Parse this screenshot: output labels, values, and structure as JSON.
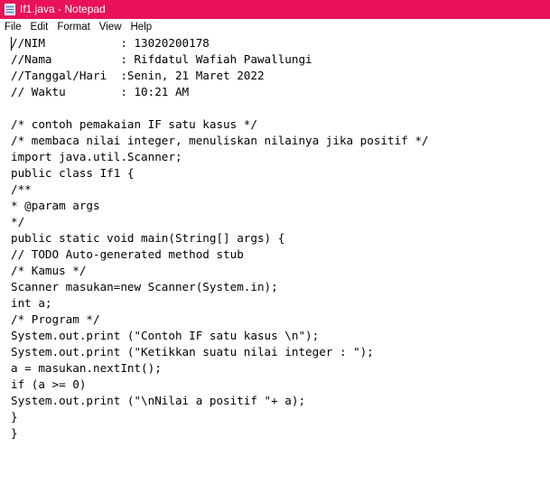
{
  "window": {
    "title": "If1.java - Notepad"
  },
  "menu": {
    "items": [
      "File",
      "Edit",
      "Format",
      "View",
      "Help"
    ]
  },
  "editor": {
    "lines": [
      "//NIM           : 13020200178",
      "//Nama          : Rifdatul Wafiah Pawallungi",
      "//Tanggal/Hari  :Senin, 21 Maret 2022",
      "// Waktu        : 10:21 AM",
      "",
      "/* contoh pemakaian IF satu kasus */",
      "/* membaca nilai integer, menuliskan nilainya jika positif */",
      "import java.util.Scanner;",
      "public class If1 {",
      "/**",
      "* @param args",
      "*/",
      "public static void main(String[] args) {",
      "// TODO Auto-generated method stub",
      "/* Kamus */",
      "Scanner masukan=new Scanner(System.in);",
      "int a;",
      "/* Program */",
      "System.out.print (\"Contoh IF satu kasus \\n\");",
      "System.out.print (\"Ketikkan suatu nilai integer : \");",
      "a = masukan.nextInt();",
      "if (a >= 0)",
      "System.out.print (\"\\nNilai a positif \"+ a);",
      "}",
      "}"
    ]
  },
  "colors": {
    "titlebar_background": "#e8115a",
    "titlebar_text": "#ffffff",
    "editor_background": "#ffffff",
    "editor_text": "#000000"
  },
  "icons": {
    "app": "notepad-icon"
  }
}
